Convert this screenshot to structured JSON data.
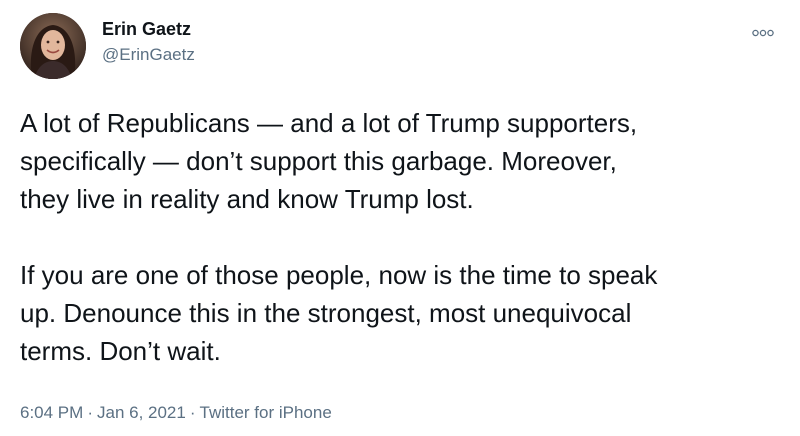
{
  "author": {
    "name": "Erin Gaetz",
    "handle": "@ErinGaetz"
  },
  "tweet": {
    "paragraph1": [
      "A lot of Republicans — and a lot of Trump supporters,",
      "specifically — don’t support this garbage. Moreover,",
      "they live in reality and know Trump lost."
    ],
    "paragraph2": [
      "If you are one of those people, now is the time to speak",
      "up. Denounce this in the strongest, most unequivocal",
      "terms. Don’t wait."
    ]
  },
  "meta": {
    "time": "6:04 PM",
    "date": "Jan 6, 2021",
    "source": "Twitter for iPhone",
    "separator": "·"
  },
  "icons": {
    "more": "more-options-icon",
    "avatar": "profile-avatar"
  },
  "colors": {
    "text": "#0f1419",
    "secondary": "#5b7083"
  }
}
